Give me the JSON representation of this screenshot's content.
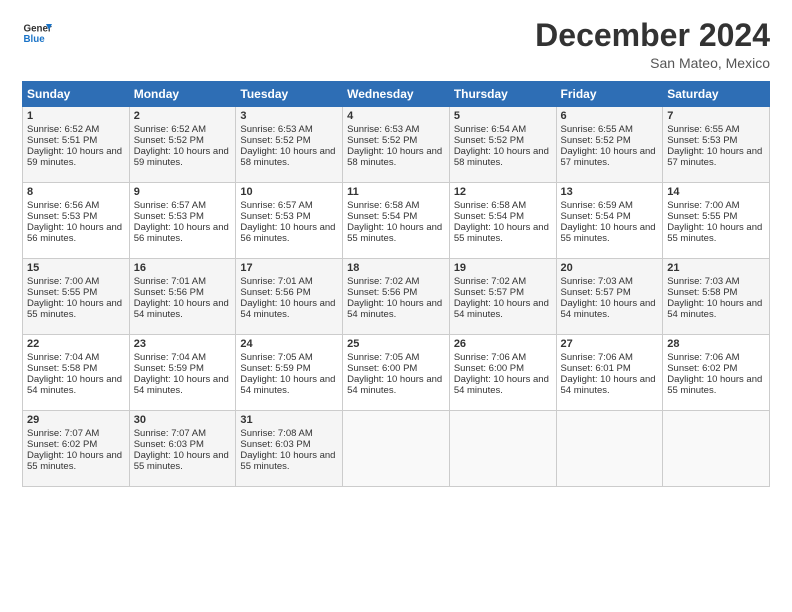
{
  "logo": {
    "line1": "General",
    "line2": "Blue"
  },
  "title": "December 2024",
  "location": "San Mateo, Mexico",
  "days_header": [
    "Sunday",
    "Monday",
    "Tuesday",
    "Wednesday",
    "Thursday",
    "Friday",
    "Saturday"
  ],
  "weeks": [
    [
      {
        "day": "1",
        "sunrise": "6:52 AM",
        "sunset": "5:51 PM",
        "daylight": "10 hours and 59 minutes."
      },
      {
        "day": "2",
        "sunrise": "6:52 AM",
        "sunset": "5:52 PM",
        "daylight": "10 hours and 59 minutes."
      },
      {
        "day": "3",
        "sunrise": "6:53 AM",
        "sunset": "5:52 PM",
        "daylight": "10 hours and 58 minutes."
      },
      {
        "day": "4",
        "sunrise": "6:53 AM",
        "sunset": "5:52 PM",
        "daylight": "10 hours and 58 minutes."
      },
      {
        "day": "5",
        "sunrise": "6:54 AM",
        "sunset": "5:52 PM",
        "daylight": "10 hours and 58 minutes."
      },
      {
        "day": "6",
        "sunrise": "6:55 AM",
        "sunset": "5:52 PM",
        "daylight": "10 hours and 57 minutes."
      },
      {
        "day": "7",
        "sunrise": "6:55 AM",
        "sunset": "5:53 PM",
        "daylight": "10 hours and 57 minutes."
      }
    ],
    [
      {
        "day": "8",
        "sunrise": "6:56 AM",
        "sunset": "5:53 PM",
        "daylight": "10 hours and 56 minutes."
      },
      {
        "day": "9",
        "sunrise": "6:57 AM",
        "sunset": "5:53 PM",
        "daylight": "10 hours and 56 minutes."
      },
      {
        "day": "10",
        "sunrise": "6:57 AM",
        "sunset": "5:53 PM",
        "daylight": "10 hours and 56 minutes."
      },
      {
        "day": "11",
        "sunrise": "6:58 AM",
        "sunset": "5:54 PM",
        "daylight": "10 hours and 55 minutes."
      },
      {
        "day": "12",
        "sunrise": "6:58 AM",
        "sunset": "5:54 PM",
        "daylight": "10 hours and 55 minutes."
      },
      {
        "day": "13",
        "sunrise": "6:59 AM",
        "sunset": "5:54 PM",
        "daylight": "10 hours and 55 minutes."
      },
      {
        "day": "14",
        "sunrise": "7:00 AM",
        "sunset": "5:55 PM",
        "daylight": "10 hours and 55 minutes."
      }
    ],
    [
      {
        "day": "15",
        "sunrise": "7:00 AM",
        "sunset": "5:55 PM",
        "daylight": "10 hours and 55 minutes."
      },
      {
        "day": "16",
        "sunrise": "7:01 AM",
        "sunset": "5:56 PM",
        "daylight": "10 hours and 54 minutes."
      },
      {
        "day": "17",
        "sunrise": "7:01 AM",
        "sunset": "5:56 PM",
        "daylight": "10 hours and 54 minutes."
      },
      {
        "day": "18",
        "sunrise": "7:02 AM",
        "sunset": "5:56 PM",
        "daylight": "10 hours and 54 minutes."
      },
      {
        "day": "19",
        "sunrise": "7:02 AM",
        "sunset": "5:57 PM",
        "daylight": "10 hours and 54 minutes."
      },
      {
        "day": "20",
        "sunrise": "7:03 AM",
        "sunset": "5:57 PM",
        "daylight": "10 hours and 54 minutes."
      },
      {
        "day": "21",
        "sunrise": "7:03 AM",
        "sunset": "5:58 PM",
        "daylight": "10 hours and 54 minutes."
      }
    ],
    [
      {
        "day": "22",
        "sunrise": "7:04 AM",
        "sunset": "5:58 PM",
        "daylight": "10 hours and 54 minutes."
      },
      {
        "day": "23",
        "sunrise": "7:04 AM",
        "sunset": "5:59 PM",
        "daylight": "10 hours and 54 minutes."
      },
      {
        "day": "24",
        "sunrise": "7:05 AM",
        "sunset": "5:59 PM",
        "daylight": "10 hours and 54 minutes."
      },
      {
        "day": "25",
        "sunrise": "7:05 AM",
        "sunset": "6:00 PM",
        "daylight": "10 hours and 54 minutes."
      },
      {
        "day": "26",
        "sunrise": "7:06 AM",
        "sunset": "6:00 PM",
        "daylight": "10 hours and 54 minutes."
      },
      {
        "day": "27",
        "sunrise": "7:06 AM",
        "sunset": "6:01 PM",
        "daylight": "10 hours and 54 minutes."
      },
      {
        "day": "28",
        "sunrise": "7:06 AM",
        "sunset": "6:02 PM",
        "daylight": "10 hours and 55 minutes."
      }
    ],
    [
      {
        "day": "29",
        "sunrise": "7:07 AM",
        "sunset": "6:02 PM",
        "daylight": "10 hours and 55 minutes."
      },
      {
        "day": "30",
        "sunrise": "7:07 AM",
        "sunset": "6:03 PM",
        "daylight": "10 hours and 55 minutes."
      },
      {
        "day": "31",
        "sunrise": "7:08 AM",
        "sunset": "6:03 PM",
        "daylight": "10 hours and 55 minutes."
      },
      null,
      null,
      null,
      null
    ]
  ]
}
